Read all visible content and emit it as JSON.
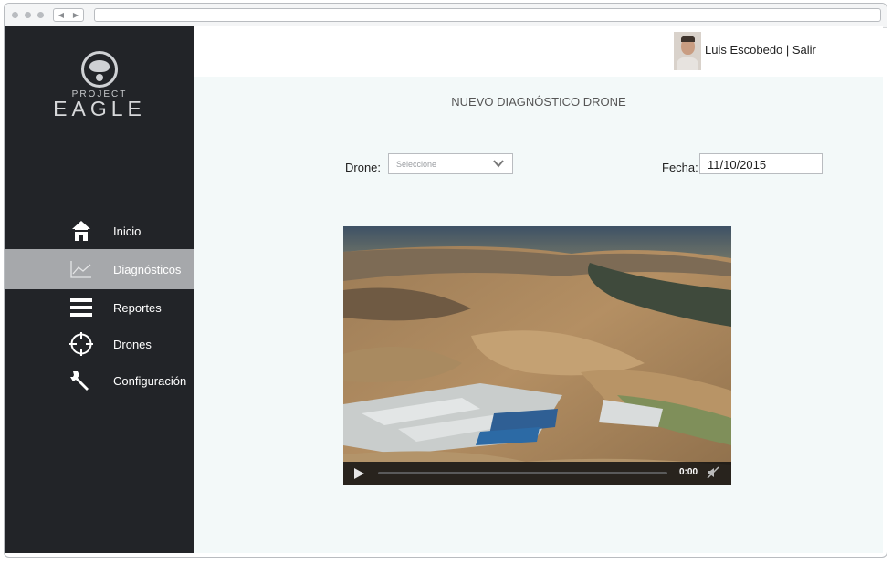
{
  "sidebar": {
    "logo": {
      "line1": "PROJECT",
      "line2": "EAGLE"
    },
    "items": [
      {
        "label": "Inicio",
        "icon": "home-icon"
      },
      {
        "label": "Diagnósticos",
        "icon": "chart-icon",
        "active": true
      },
      {
        "label": "Reportes",
        "icon": "list-icon"
      },
      {
        "label": "Drones",
        "icon": "crosshair-icon"
      },
      {
        "label": "Configuración",
        "icon": "wrench-icon"
      }
    ]
  },
  "header": {
    "user_label": "Luis Escobedo | Salir"
  },
  "main": {
    "title": "NUEVO DIAGNÓSTICO DRONE",
    "drone_label": "Drone:",
    "drone_select": {
      "value": "Seleccione"
    },
    "fecha_label": "Fecha:",
    "fecha_value": "11/10/2015",
    "video": {
      "time": "0:00"
    }
  },
  "colors": {
    "sidebar_bg": "#222428",
    "active_item_bg": "#a6a8ab",
    "content_bg": "#f3f9f9"
  }
}
